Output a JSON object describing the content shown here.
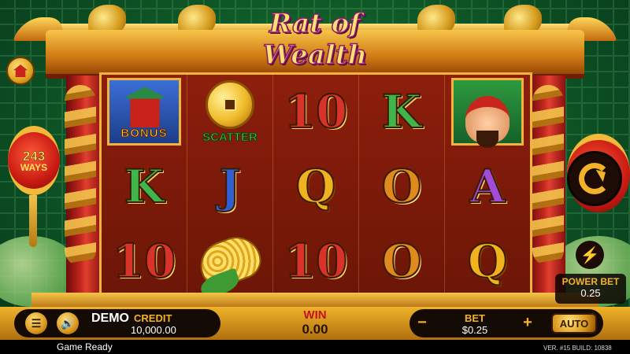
{
  "game": {
    "logo_text": "Rat of Wealth",
    "ways_number": "243",
    "ways_label": "WAYS"
  },
  "reels": [
    [
      {
        "type": "bonus",
        "label": "BONUS"
      },
      {
        "type": "letter",
        "text": "K",
        "color": "green"
      },
      {
        "type": "letter",
        "text": "10",
        "color": "red"
      }
    ],
    [
      {
        "type": "scatter",
        "label": "SCATTER"
      },
      {
        "type": "letter",
        "text": "J",
        "color": "blue"
      },
      {
        "type": "corn"
      }
    ],
    [
      {
        "type": "letter",
        "text": "10",
        "color": "red"
      },
      {
        "type": "letter",
        "text": "Q",
        "color": "gold"
      },
      {
        "type": "letter",
        "text": "10",
        "color": "red"
      }
    ],
    [
      {
        "type": "letter",
        "text": "K",
        "color": "green"
      },
      {
        "type": "letter",
        "text": "O",
        "color": "orange"
      },
      {
        "type": "letter",
        "text": "O",
        "color": "orange"
      }
    ],
    [
      {
        "type": "god"
      },
      {
        "type": "letter",
        "text": "A",
        "color": "purple"
      },
      {
        "type": "letter",
        "text": "Q",
        "color": "gold"
      }
    ]
  ],
  "controls": {
    "home_icon": "home-icon",
    "spin_icon": "spin-icon",
    "power_icon": "lightning-icon",
    "power_bet_label": "POWER BET",
    "power_bet_value": "0.25",
    "menu_icon": "menu-icon",
    "sound_icon": "sound-icon",
    "demo_label": "DEMO",
    "credit_label": "CREDIT",
    "credit_value": "10,000.00",
    "win_label": "WIN",
    "win_value": "0.00",
    "bet_minus": "−",
    "bet_label": "BET",
    "bet_value": "$0.25",
    "bet_plus": "+",
    "auto_label": "AUTO"
  },
  "status": {
    "message": "Game Ready",
    "version": "VER. #15  BUILD: 10838"
  }
}
